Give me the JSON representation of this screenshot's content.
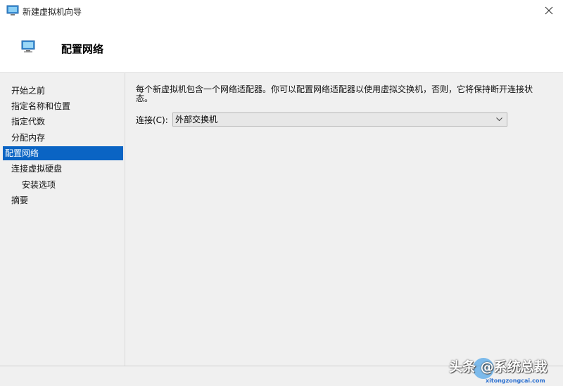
{
  "window": {
    "title": "新建虚拟机向导"
  },
  "header": {
    "title": "配置网络"
  },
  "sidebar": {
    "items": [
      {
        "label": "开始之前"
      },
      {
        "label": "指定名称和位置"
      },
      {
        "label": "指定代数"
      },
      {
        "label": "分配内存"
      },
      {
        "label": "配置网络",
        "active": true
      },
      {
        "label": "连接虚拟硬盘"
      },
      {
        "label": "安装选项"
      },
      {
        "label": "摘要"
      }
    ]
  },
  "main": {
    "description": "每个新虚拟机包含一个网络适配器。你可以配置网络适配器以使用虚拟交换机，否则，它将保持断开连接状态。",
    "connection_label": "连接(C):",
    "connection_value": "外部交换机"
  },
  "watermark": {
    "text": "头条 @系统总裁",
    "url": "xitongzongcai.com"
  },
  "colors": {
    "accent": "#0a64c4"
  }
}
